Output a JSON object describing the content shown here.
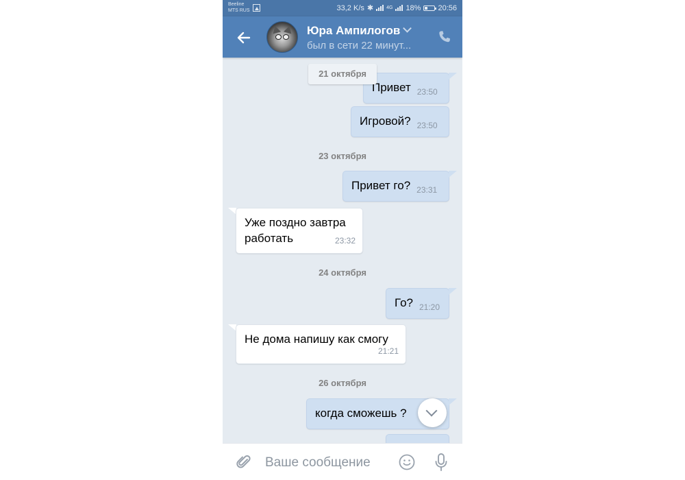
{
  "status_bar": {
    "carrier1": "Beeline",
    "carrier2": "MTS RUS",
    "speed": "33,2 K/s",
    "network": "4G",
    "battery": "18%",
    "time": "20:56"
  },
  "header": {
    "contact_name": "Юра Ампилогов",
    "status": "был в сети 22 минут..."
  },
  "messages": [
    {
      "date": "21 октября"
    },
    {
      "direction": "out",
      "text": "Привет",
      "time": "23:50"
    },
    {
      "direction": "out",
      "text": "Игровой?",
      "time": "23:50"
    },
    {
      "date": "23 октября"
    },
    {
      "direction": "out",
      "text": "Привет го?",
      "time": "23:31"
    },
    {
      "direction": "in",
      "text": "Уже поздно завтра работать",
      "time": "23:32"
    },
    {
      "date": "24 октября"
    },
    {
      "direction": "out",
      "text": "Го?",
      "time": "21:20"
    },
    {
      "direction": "in",
      "text": "Не дома напишу как смогу",
      "time": "21:21"
    },
    {
      "date": "26 октября"
    },
    {
      "direction": "out",
      "text": "когда сможешь ?",
      "time": ""
    }
  ],
  "composer": {
    "placeholder": "Ваше сообщение"
  },
  "icons": {
    "back": "arrow-left-icon",
    "call": "phone-icon",
    "attach": "paperclip-icon",
    "emoji": "smile-icon",
    "mic": "microphone-icon",
    "scroll": "chevron-down-icon"
  },
  "colors": {
    "header": "#5181b8",
    "statusbar": "#4a76a8",
    "chat_bg": "#e5ebf1",
    "outgoing_bubble": "#cfdff1",
    "incoming_bubble": "#ffffff"
  }
}
